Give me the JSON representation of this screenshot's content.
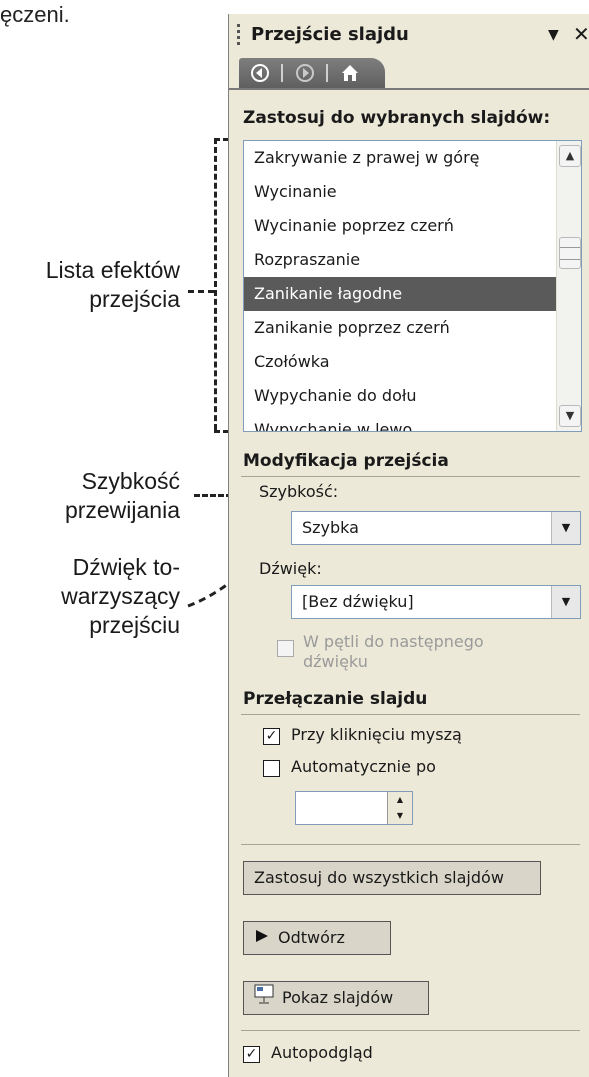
{
  "doc_fragment": "ęczeni.",
  "callouts": {
    "effects_list": [
      "Lista efektów",
      "przejścia"
    ],
    "speed": [
      "Szybkość",
      "przewijania"
    ],
    "sound": [
      "Dźwięk to-",
      "warzyszący",
      "przejściu"
    ]
  },
  "pane": {
    "title": "Przejście slajdu",
    "nav": {
      "back_icon": "back-arrow-icon",
      "forward_icon": "forward-arrow-icon",
      "home_icon": "home-icon"
    },
    "apply_section_label": "Zastosuj do wybranych slajdów:",
    "effects": [
      "Zakrywanie z prawej w górę",
      "Wycinanie",
      "Wycinanie poprzez czerń",
      "Rozpraszanie",
      "Zanikanie łagodne",
      "Zanikanie poprzez czerń",
      "Czołówka",
      "Wypychanie do dołu",
      "Wypychanie w lewo"
    ],
    "selected_effect": "Zanikanie łagodne",
    "modify_section_label": "Modyfikacja przejścia",
    "speed_label": "Szybkość:",
    "speed_value": "Szybka",
    "sound_label": "Dźwięk:",
    "sound_value": "[Bez dźwięku]",
    "loop_label": [
      "W pętli do następnego",
      "dźwięku"
    ],
    "advance_section_label": "Przełączanie slajdu",
    "on_click_label": "Przy kliknięciu myszą",
    "on_click_checked": true,
    "auto_label": "Automatycznie po",
    "auto_checked": false,
    "auto_value": "",
    "apply_all_label": "Zastosuj do wszystkich slajdów",
    "play_label": "Odtwórz",
    "slideshow_label": "Pokaz slajdów",
    "autopreview_label": "Autopodgląd",
    "autopreview_checked": true,
    "colors": {
      "pane_bg": "#ece9d8",
      "selection": "#5a5a5a",
      "nav_bar": "#6e6e6e"
    }
  }
}
